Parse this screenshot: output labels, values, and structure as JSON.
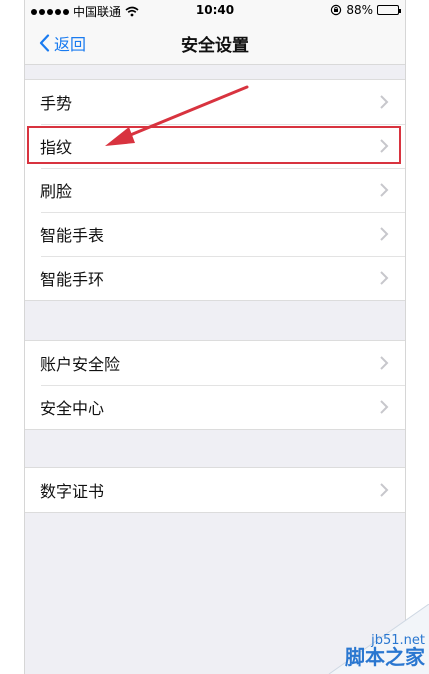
{
  "status_bar": {
    "carrier": "中国联通",
    "time": "10:40",
    "battery": "88%",
    "battery_level": 0.88
  },
  "nav": {
    "back_label": "返回",
    "title": "安全设置"
  },
  "groups": [
    {
      "items": [
        "手势",
        "指纹",
        "刷脸",
        "智能手表",
        "智能手环"
      ]
    },
    {
      "items": [
        "账户安全险",
        "安全中心"
      ]
    },
    {
      "items": [
        "数字证书"
      ]
    }
  ],
  "annotation": {
    "highlighted_item": "指纹",
    "color": "#d8333f"
  },
  "watermark": {
    "site": "jb51.net",
    "name": "脚本之家"
  },
  "colors": {
    "accent": "#1a7bf0",
    "background": "#efeff4",
    "chevron": "#c7c7cc"
  }
}
